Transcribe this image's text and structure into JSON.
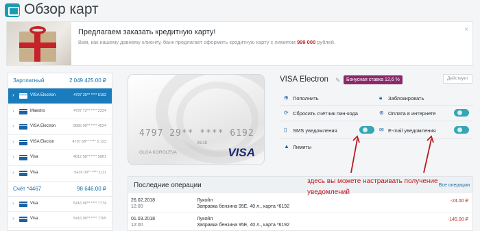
{
  "header": {
    "title": "Обзор карт",
    "icon": "card-icon"
  },
  "banner": {
    "title": "Предлагаем заказать кредитную карту!",
    "text_before": "Вам, как нашему давнему клиенту, банк предлагает оформить кредитную карту с лимитом",
    "limit": "999 000",
    "text_after": "рублей.",
    "close": "×"
  },
  "sidebar": {
    "accounts": [
      {
        "name": "Зарплатный",
        "sum": "2 049 425.00 ₽",
        "cards": [
          {
            "name": "VISA Electron",
            "number": "4797 29** **** 6192",
            "active": true
          },
          {
            "name": "Maestro",
            "number": "4797 72** **** 2224"
          },
          {
            "name": "VISA Electron",
            "number": "8885 99** **** 4524"
          },
          {
            "name": "VISA Electon",
            "number": "4797 68** **** 5 123"
          },
          {
            "name": "Visa",
            "number": "4812 58** **** 5881"
          },
          {
            "name": "Visa",
            "number": "5416 00** **** 1111"
          }
        ]
      },
      {
        "name": "Счёт *4467",
        "sum": "98 646.00 ₽",
        "cards": [
          {
            "name": "Visa",
            "number": "5416 00** **** 7774"
          },
          {
            "name": "Visa",
            "number": "5416 00** **** 7765"
          }
        ]
      }
    ]
  },
  "card": {
    "number": "4797 29** **** 6192",
    "expiry": "06/18",
    "holder": "OLGA KOROLEVA",
    "brand": "VISA"
  },
  "details": {
    "title": "VISA Electron",
    "bonus": "Бонусная ставка 12,6 %",
    "status": "Действует",
    "actions": {
      "topup": "Пополнить",
      "block": "Заблокировать",
      "reset_pin": "Сбросить счётчик пин-кода",
      "online_pay": "Оплата в интернете",
      "sms": "SMS уведомления",
      "email": "E-mail уведомления",
      "limits": "Лимиты"
    }
  },
  "annotation": "здесь вы можете настраивать получение уведомлений",
  "operations": {
    "title": "Последние операции",
    "all_link": "Все операции",
    "rows": [
      {
        "date": "26.02.2018",
        "time": "12:00",
        "merchant": "Лукойл",
        "desc": "Заправка бензина 95Е, 40 л., карта *6192",
        "amount": "-24.00 ₽"
      },
      {
        "date": "01.03.2018",
        "time": "12:00",
        "merchant": "Лукойл",
        "desc": "Заправка бензина 95Е, 40 л., карта *6192",
        "amount": "-145.00 ₽"
      }
    ]
  },
  "colors": {
    "accent": "#1a7cbc",
    "teal": "#1a9bb0",
    "bonus_badge": "#8b2a6a",
    "toggle_on": "#35a6b5",
    "annotation": "#c0161d",
    "negative_amount": "#c4232a"
  }
}
